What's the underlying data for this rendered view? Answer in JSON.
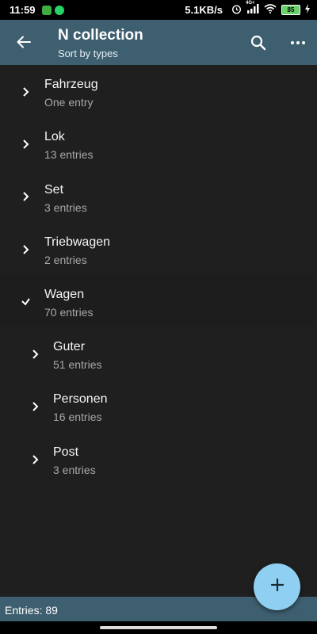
{
  "status_bar": {
    "time": "11:59",
    "network_speed": "5.1KB/s",
    "battery": "85",
    "network_type": "4G+"
  },
  "app_bar": {
    "title": "N collection",
    "subtitle": "Sort by types",
    "icons": [
      "back-arrow-icon",
      "search-icon",
      "more-icon"
    ]
  },
  "list": {
    "items": [
      {
        "label": "Fahrzeug",
        "count": "One entry",
        "expanded": false,
        "level": 0
      },
      {
        "label": "Lok",
        "count": "13 entries",
        "expanded": false,
        "level": 0
      },
      {
        "label": "Set",
        "count": "3 entries",
        "expanded": false,
        "level": 0
      },
      {
        "label": "Triebwagen",
        "count": "2 entries",
        "expanded": false,
        "level": 0
      },
      {
        "label": "Wagen",
        "count": "70 entries",
        "expanded": true,
        "level": 0
      },
      {
        "label": "Guter",
        "count": "51 entries",
        "expanded": false,
        "level": 1
      },
      {
        "label": "Personen",
        "count": "16 entries",
        "expanded": false,
        "level": 1
      },
      {
        "label": "Post",
        "count": "3 entries",
        "expanded": false,
        "level": 1
      }
    ]
  },
  "footer": {
    "entries": "Entries: 89"
  },
  "fab": {
    "icon": "add-icon"
  },
  "colors": {
    "app_bar": "#3e5f6f",
    "background": "#1f1f1f",
    "fab": "#8fd0f2"
  }
}
